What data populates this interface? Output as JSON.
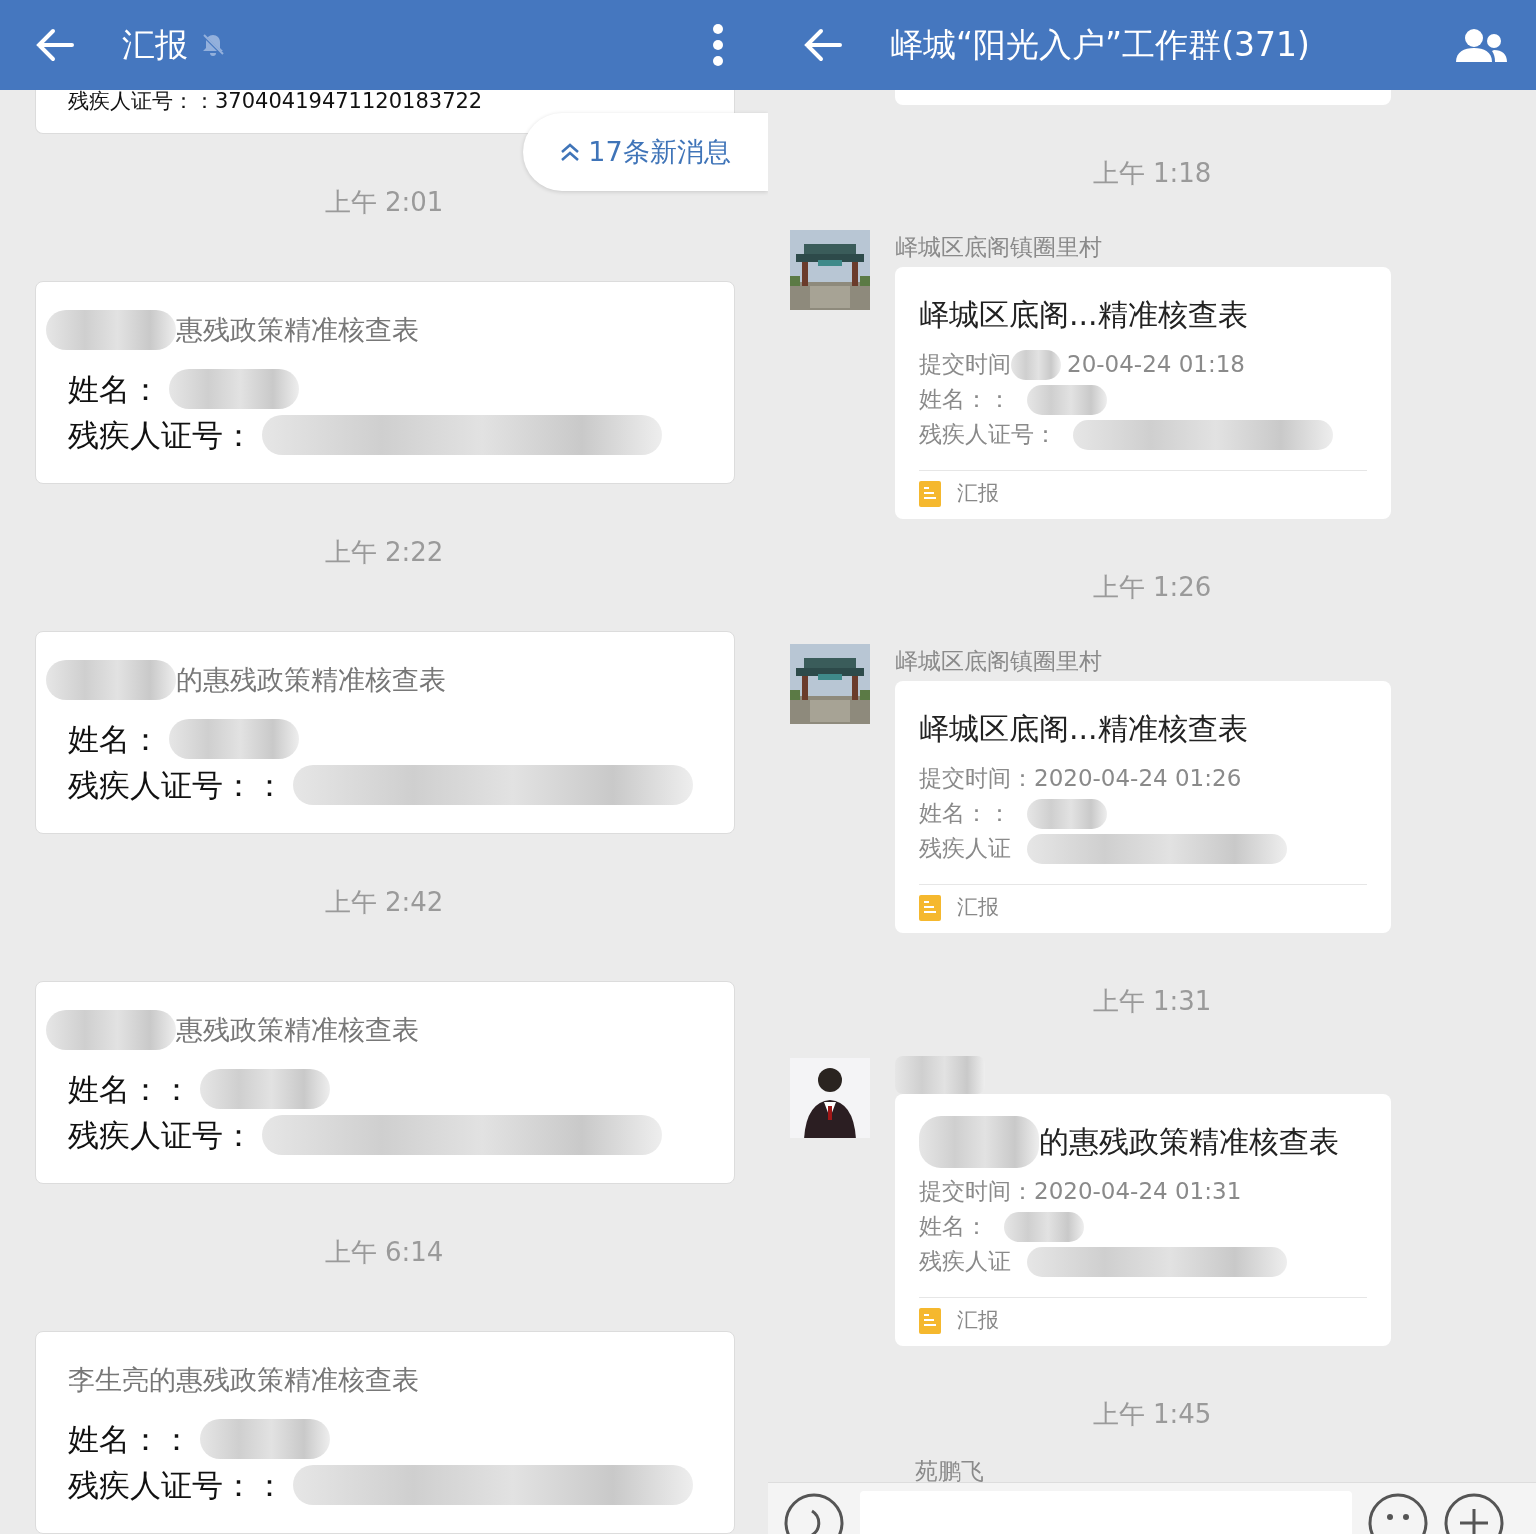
{
  "left": {
    "title": "汇报",
    "muted": true,
    "top_line": "残疾人证号：：37040419471120183722",
    "new_messages": "17条新消息",
    "messages": [
      {
        "time": "上午 2:01",
        "title": "惠残政策精准核查表",
        "title_redacted": true,
        "name_label": "姓名：",
        "id_label": "残疾人证号："
      },
      {
        "time": "上午 2:22",
        "title": "的惠残政策精准核查表",
        "title_redacted": true,
        "name_label": "姓名：",
        "id_label": "残疾人证号：："
      },
      {
        "time": "上午 2:42",
        "title": "惠残政策精准核查表",
        "title_redacted": true,
        "name_label": "姓名：：",
        "id_label": "残疾人证号："
      },
      {
        "time": "上午 6:14",
        "title": "李生亮的惠残政策精准核查表",
        "title_redacted": false,
        "name_label": "姓名：：",
        "id_label": "残疾人证号：："
      }
    ]
  },
  "right": {
    "title": "峄城“阳光入户”工作群(371)",
    "messages": [
      {
        "time": "上午 1:18",
        "sender": "峄城区底阁镇圈里村",
        "title": "峄城区底阁...精准核查表",
        "title_redacted": false,
        "submitted_label": "提交时间",
        "submitted": "20-04-24 01:18",
        "submitted_redacted": true,
        "name_label": "姓名：：",
        "id_label": "残疾人证号：",
        "tag": "汇报"
      },
      {
        "time": "上午 1:26",
        "sender": "峄城区底阁镇圈里村",
        "title": "峄城区底阁...精准核查表",
        "title_redacted": false,
        "submitted_label": "提交时间：",
        "submitted": "2020-04-24 01:26",
        "submitted_redacted": false,
        "name_label": "姓名：：",
        "id_label": "残疾人证",
        "tag": "汇报"
      },
      {
        "time": "上午 1:31",
        "title": "的惠残政策精准核查表",
        "title_redacted": true,
        "submitted_label": "提交时间：",
        "submitted": "2020-04-24 01:31",
        "submitted_redacted": false,
        "name_label": "姓名：",
        "id_label": "残疾人证",
        "tag": "汇报"
      }
    ],
    "last_time": "上午 1:45",
    "next_sender": "苑鹏飞"
  }
}
